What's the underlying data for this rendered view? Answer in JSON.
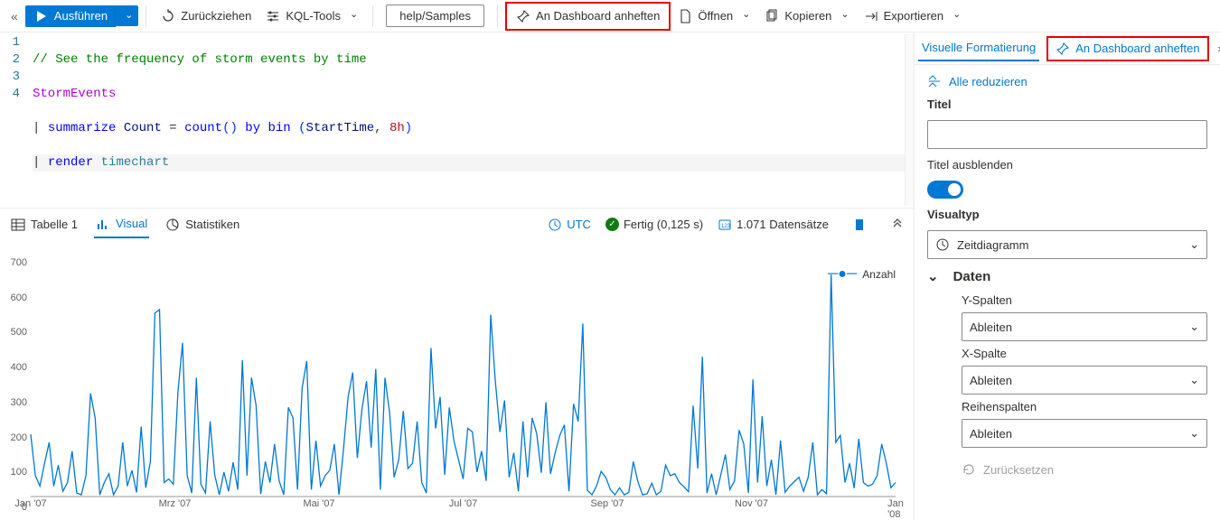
{
  "toolbar": {
    "run": "Ausführen",
    "recall": "Zurückziehen",
    "kql": "KQL-Tools",
    "help": "help/Samples",
    "pin": "An Dashboard anheften",
    "open": "Öffnen",
    "copy": "Kopieren",
    "export": "Exportieren"
  },
  "editor": {
    "lines": [
      "1",
      "2",
      "3",
      "4"
    ],
    "l1": "// See the frequency of storm events by time",
    "l2a": "StormEvents",
    "l3_pipe": "| ",
    "l3_summarize": "summarize",
    "l3_count_var": " Count ",
    "l3_eq": "= ",
    "l3_countfn": "count",
    "l3_p1": "()",
    "l3_by": " by ",
    "l3_bin": "bin ",
    "l3_po": "(",
    "l3_start": "StartTime",
    "l3_comma": ", ",
    "l3_dur": "8h",
    "l3_pc": ")",
    "l4_pipe": "| ",
    "l4_render": "render",
    "l4_tc": " timechart"
  },
  "tabs": {
    "table": "Tabelle 1",
    "visual": "Visual",
    "stats": "Statistiken",
    "utc": "UTC",
    "done": "Fertig (0,125 s)",
    "records": "1.071 Datensätze"
  },
  "legend": {
    "series1": "Anzahl"
  },
  "rpanel": {
    "heading": "Visuelle Formatierung",
    "pin": "An Dashboard anheften",
    "collapse": "Alle reduzieren",
    "title_lbl": "Titel",
    "title_val": "",
    "hide_title": "Titel ausblenden",
    "visualtype_lbl": "Visualtyp",
    "visualtype_val": "Zeitdiagramm",
    "data_section": "Daten",
    "ycols": "Y-Spalten",
    "xcol": "X-Spalte",
    "seriescols": "Reihenspalten",
    "infer": "Ableiten",
    "reset": "Zurücksetzen"
  },
  "chart_data": {
    "type": "line",
    "title": "",
    "xlabel": "",
    "ylabel": "",
    "ylim": [
      0,
      700
    ],
    "yticks": [
      0,
      100,
      200,
      300,
      400,
      500,
      600,
      700
    ],
    "xticks": [
      "Jan '07",
      "Mrz '07",
      "Mai '07",
      "Jul '07",
      "Sep '07",
      "Nov '07",
      "Jan '08"
    ],
    "series": [
      {
        "name": "Anzahl",
        "color": "#0078d4",
        "values": [
          178,
          60,
          30,
          95,
          155,
          30,
          90,
          15,
          40,
          130,
          10,
          5,
          60,
          295,
          225,
          5,
          40,
          65,
          5,
          30,
          155,
          30,
          75,
          12,
          200,
          25,
          100,
          525,
          535,
          40,
          50,
          35,
          300,
          440,
          60,
          10,
          340,
          35,
          10,
          215,
          62,
          5,
          70,
          15,
          98,
          20,
          390,
          60,
          340,
          260,
          7,
          100,
          40,
          150,
          45,
          5,
          255,
          225,
          20,
          310,
          388,
          20,
          160,
          30,
          60,
          75,
          150,
          5,
          135,
          285,
          355,
          110,
          250,
          330,
          140,
          365,
          20,
          340,
          240,
          55,
          105,
          245,
          80,
          95,
          215,
          40,
          10,
          425,
          195,
          285,
          62,
          255,
          160,
          105,
          50,
          195,
          185,
          70,
          130,
          45,
          520,
          330,
          185,
          275,
          55,
          125,
          15,
          215,
          55,
          225,
          180,
          68,
          270,
          65,
          125,
          175,
          205,
          15,
          265,
          215,
          495,
          18,
          5,
          30,
          72,
          55,
          20,
          5,
          25,
          5,
          12,
          100,
          42,
          5,
          8,
          38,
          5,
          15,
          90,
          60,
          65,
          40,
          28,
          14,
          260,
          80,
          400,
          10,
          65,
          5,
          62,
          120,
          20,
          45,
          190,
          150,
          10,
          335,
          40,
          230,
          30,
          105,
          5,
          160,
          12,
          30,
          43,
          55,
          15,
          55,
          155,
          5,
          20,
          8,
          635,
          155,
          175,
          40,
          95,
          24,
          165,
          40,
          30,
          35,
          60,
          150,
          95,
          25,
          40
        ]
      }
    ]
  }
}
